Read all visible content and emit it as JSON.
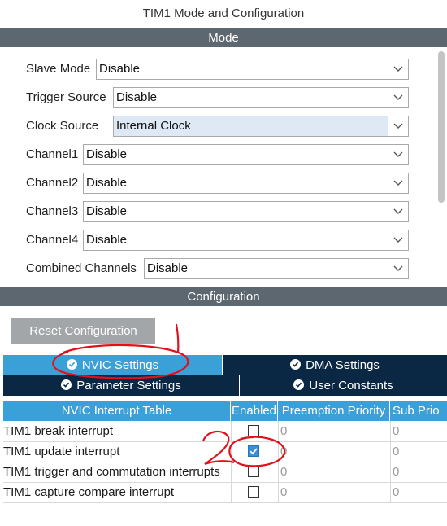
{
  "window": {
    "title": "TIM1 Mode and Configuration"
  },
  "mode": {
    "header": "Mode",
    "fields": [
      {
        "label": "Slave Mode",
        "value": "Disable"
      },
      {
        "label": "Trigger Source",
        "value": "Disable"
      },
      {
        "label": "Clock Source",
        "value": "Internal Clock"
      },
      {
        "label": "Channel1",
        "value": "Disable"
      },
      {
        "label": "Channel2",
        "value": "Disable"
      },
      {
        "label": "Channel3",
        "value": "Disable"
      },
      {
        "label": "Channel4",
        "value": "Disable"
      },
      {
        "label": "Combined Channels",
        "value": "Disable"
      }
    ]
  },
  "configuration": {
    "header": "Configuration",
    "reset_button": "Reset Configuration",
    "tabs": [
      {
        "label": "NVIC Settings",
        "active": true
      },
      {
        "label": "DMA Settings",
        "active": false
      },
      {
        "label": "Parameter Settings",
        "active": false
      },
      {
        "label": "User Constants",
        "active": false
      }
    ],
    "table": {
      "columns": [
        "NVIC Interrupt Table",
        "Enabled",
        "Preemption Priority",
        "Sub Prio"
      ],
      "rows": [
        {
          "name": "TIM1 break interrupt",
          "enabled": false,
          "preemption": "0",
          "sub": "0"
        },
        {
          "name": "TIM1 update interrupt",
          "enabled": true,
          "preemption": "0",
          "sub": "0"
        },
        {
          "name": "TIM1 trigger and commutation interrupts",
          "enabled": false,
          "preemption": "0",
          "sub": "0"
        },
        {
          "name": "TIM1 capture compare interrupt",
          "enabled": false,
          "preemption": "0",
          "sub": "0"
        }
      ]
    }
  },
  "annotations": {
    "mark1": "1",
    "mark2": "2"
  },
  "colors": {
    "accent": "#3b9fd8",
    "dark_tab": "#0a2744",
    "section_bar": "#5d6770",
    "annotation_ink": "#e0111b"
  }
}
